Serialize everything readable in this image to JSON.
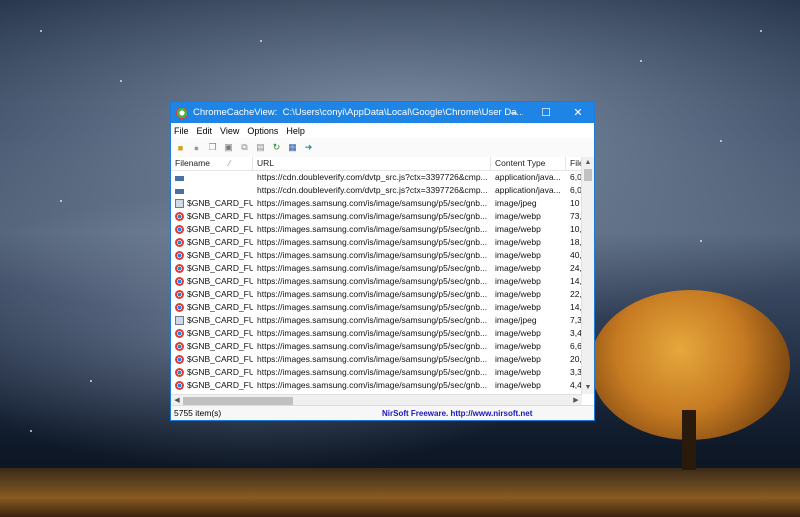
{
  "window": {
    "app_name": "ChromeCacheView:",
    "path": "C:\\Users\\conyi\\AppData\\Local\\Google\\Chrome\\User Da..."
  },
  "title_buttons": {
    "minimize": "–",
    "maximize": "☐",
    "close": "✕"
  },
  "menu": [
    "File",
    "Edit",
    "View",
    "Options",
    "Help"
  ],
  "columns": [
    "Filename",
    "URL",
    "Content Type",
    "File"
  ],
  "rows": [
    {
      "icon": "gen",
      "filename": "",
      "url": "https://cdn.doubleverify.com/dvtp_src.js?ctx=3397726&cmp...",
      "type": "application/java...",
      "size": "6,0"
    },
    {
      "icon": "gen",
      "filename": "",
      "url": "https://cdn.doubleverify.com/dvtp_src.js?ctx=3397726&cmp...",
      "type": "application/java...",
      "size": "6,0"
    },
    {
      "icon": "doc",
      "filename": "$GNB_CARD_FU...",
      "url": "https://images.samsung.com/is/image/samsung/p5/sec/gnb...",
      "type": "image/jpeg",
      "size": "10"
    },
    {
      "icon": "chrome",
      "filename": "$GNB_CARD_FU...",
      "url": "https://images.samsung.com/is/image/samsung/p5/sec/gnb...",
      "type": "image/webp",
      "size": "73,"
    },
    {
      "icon": "chrome",
      "filename": "$GNB_CARD_FU...",
      "url": "https://images.samsung.com/is/image/samsung/p5/sec/gnb...",
      "type": "image/webp",
      "size": "10,"
    },
    {
      "icon": "chrome",
      "filename": "$GNB_CARD_FU...",
      "url": "https://images.samsung.com/is/image/samsung/p5/sec/gnb...",
      "type": "image/webp",
      "size": "18,"
    },
    {
      "icon": "chrome",
      "filename": "$GNB_CARD_FU...",
      "url": "https://images.samsung.com/is/image/samsung/p5/sec/gnb...",
      "type": "image/webp",
      "size": "40,"
    },
    {
      "icon": "chrome",
      "filename": "$GNB_CARD_FU...",
      "url": "https://images.samsung.com/is/image/samsung/p5/sec/gnb...",
      "type": "image/webp",
      "size": "24,"
    },
    {
      "icon": "chrome",
      "filename": "$GNB_CARD_FU...",
      "url": "https://images.samsung.com/is/image/samsung/p5/sec/gnb...",
      "type": "image/webp",
      "size": "14,"
    },
    {
      "icon": "chrome",
      "filename": "$GNB_CARD_FU...",
      "url": "https://images.samsung.com/is/image/samsung/p5/sec/gnb...",
      "type": "image/webp",
      "size": "22,"
    },
    {
      "icon": "chrome",
      "filename": "$GNB_CARD_FU...",
      "url": "https://images.samsung.com/is/image/samsung/p5/sec/gnb...",
      "type": "image/webp",
      "size": "14,"
    },
    {
      "icon": "doc",
      "filename": "$GNB_CARD_FU...",
      "url": "https://images.samsung.com/is/image/samsung/p5/sec/gnb...",
      "type": "image/jpeg",
      "size": "7,3"
    },
    {
      "icon": "chrome",
      "filename": "$GNB_CARD_FU...",
      "url": "https://images.samsung.com/is/image/samsung/p5/sec/gnb...",
      "type": "image/webp",
      "size": "3,4"
    },
    {
      "icon": "chrome",
      "filename": "$GNB_CARD_FU...",
      "url": "https://images.samsung.com/is/image/samsung/p5/sec/gnb...",
      "type": "image/webp",
      "size": "6,6"
    },
    {
      "icon": "chrome",
      "filename": "$GNB_CARD_FU...",
      "url": "https://images.samsung.com/is/image/samsung/p5/sec/gnb...",
      "type": "image/webp",
      "size": "20,"
    },
    {
      "icon": "chrome",
      "filename": "$GNB_CARD_FU...",
      "url": "https://images.samsung.com/is/image/samsung/p5/sec/gnb...",
      "type": "image/webp",
      "size": "3,3"
    },
    {
      "icon": "chrome",
      "filename": "$GNB_CARD_FU...",
      "url": "https://images.samsung.com/is/image/samsung/p5/sec/gnb...",
      "type": "image/webp",
      "size": "4,4"
    }
  ],
  "status": {
    "items": "5755 item(s)",
    "credit": "NirSoft Freeware.  http://www.nirsoft.net"
  }
}
